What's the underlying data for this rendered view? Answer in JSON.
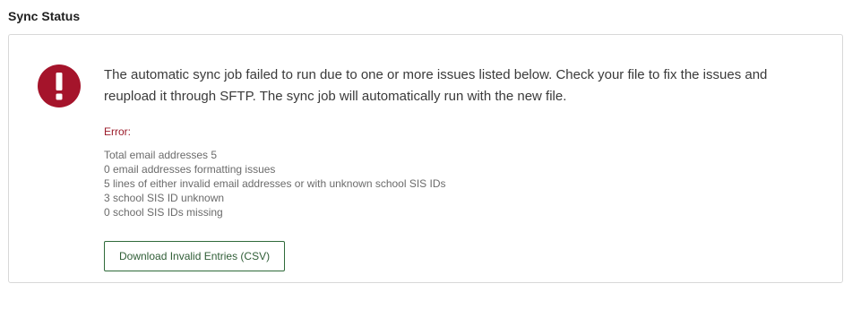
{
  "section": {
    "title": "Sync Status"
  },
  "alert": {
    "icon": "exclamation-circle-icon",
    "icon_color": "#a5142b",
    "message": "The automatic sync job failed to run due to one or more issues listed below. Check your file to fix the issues and reupload it through SFTP. The sync job will automatically run with the new file."
  },
  "error": {
    "label": "Error:",
    "items": [
      "Total email addresses 5",
      "0 email addresses formatting issues",
      "5 lines of either invalid email addresses or with unknown school SIS IDs",
      "3 school SIS ID unknown",
      "0 school SIS IDs missing"
    ]
  },
  "actions": {
    "download_label": "Download Invalid Entries (CSV)"
  },
  "colors": {
    "error_text": "#9b1b2a",
    "button_border": "#2f6b3a"
  }
}
